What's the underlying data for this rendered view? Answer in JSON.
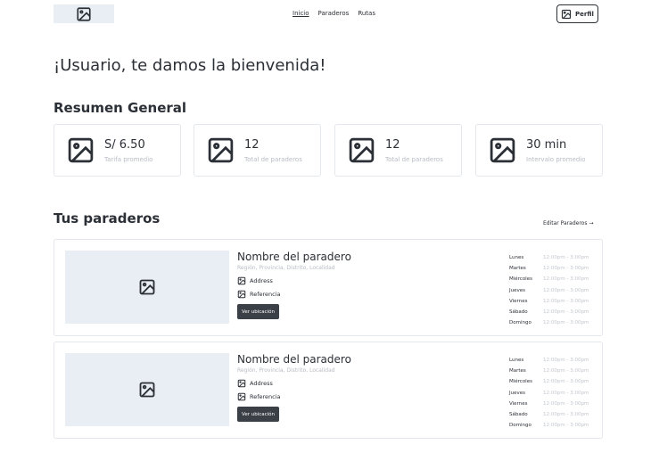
{
  "header": {
    "logo_icon": "image-icon",
    "nav": [
      {
        "label": "Inicio",
        "active": true
      },
      {
        "label": "Paraderos",
        "active": false
      },
      {
        "label": "Rutas",
        "active": false
      }
    ],
    "profile_label": "Perfil"
  },
  "welcome": "¡Usuario, te damos la bienvenida!",
  "summary": {
    "title": "Resumen General",
    "cards": [
      {
        "value": "S/ 6.50",
        "label": "Tarifa promedio"
      },
      {
        "value": "12",
        "label": "Total de paraderos"
      },
      {
        "value": "12",
        "label": "Total de paraderos"
      },
      {
        "value": "30 min",
        "label": "Intervalo promedio"
      }
    ]
  },
  "stops": {
    "title": "Tus paraderos",
    "edit_label": "Editar Paraderos →",
    "items": [
      {
        "name": "Nombre del paradero",
        "region": "Región, Provincia, Distrito, Localidad",
        "address": "Address",
        "reference": "Referencia",
        "button": "Ver ubicación",
        "schedule": [
          {
            "day": "Lunes",
            "hours": "12:00pm - 3:00pm"
          },
          {
            "day": "Martes",
            "hours": "12:00pm - 3:00pm"
          },
          {
            "day": "Miércoles",
            "hours": "12:00pm - 3:00pm"
          },
          {
            "day": "Jueves",
            "hours": "12:00pm - 3:00pm"
          },
          {
            "day": "Viernes",
            "hours": "12:00pm - 3:00pm"
          },
          {
            "day": "Sábado",
            "hours": "12:00pm - 3:00pm"
          },
          {
            "day": "Domingo",
            "hours": "12:00pm - 3:00pm"
          }
        ]
      },
      {
        "name": "Nombre del paradero",
        "region": "Región, Provincia, Distrito, Localidad",
        "address": "Address",
        "reference": "Referencia",
        "button": "Ver ubicación",
        "schedule": [
          {
            "day": "Lunes",
            "hours": "12:00pm - 3:00pm"
          },
          {
            "day": "Martes",
            "hours": "12:00pm - 3:00pm"
          },
          {
            "day": "Miércoles",
            "hours": "12:00pm - 3:00pm"
          },
          {
            "day": "Jueves",
            "hours": "12:00pm - 3:00pm"
          },
          {
            "day": "Viernes",
            "hours": "12:00pm - 3:00pm"
          },
          {
            "day": "Sábado",
            "hours": "12:00pm - 3:00pm"
          },
          {
            "day": "Domingo",
            "hours": "12:00pm - 3:00pm"
          }
        ]
      }
    ]
  }
}
